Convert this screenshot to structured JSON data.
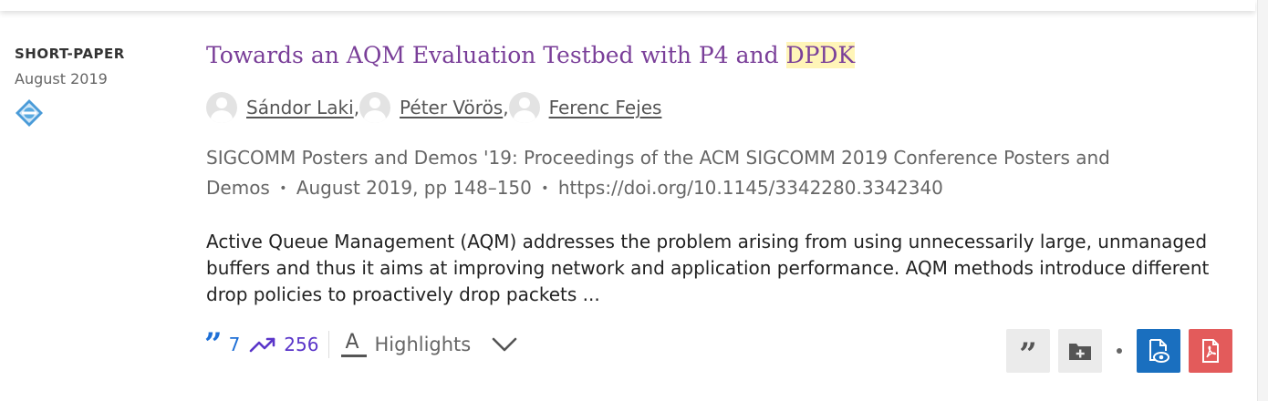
{
  "item": {
    "content_type": "SHORT-PAPER",
    "date": "August 2019",
    "badge_icon": "acm-diamond-icon",
    "title_prefix": "Towards an AQM Evaluation Testbed with P4 and ",
    "title_highlight": "DPDK",
    "authors": [
      {
        "name": "Sándor Laki",
        "sep": ","
      },
      {
        "name": "Péter Vörös",
        "sep": ","
      },
      {
        "name": "Ferenc Fejes",
        "sep": ""
      }
    ],
    "venue_line1": "SIGCOMM Posters and Demos '19: Proceedings of the ACM SIGCOMM 2019 Conference Posters and",
    "venue_line2_prefix": "Demos",
    "venue_dot": "•",
    "venue_pages": "August 2019, pp 148–150",
    "venue_doi": "https://doi.org/10.1145/3342280.3342340",
    "abstract": "Active Queue Management (AQM) addresses the problem arising from using unnecessarily large, unmanaged buffers and thus it aims at improving network and application performance. AQM methods introduce different drop policies to proactively drop packets ...",
    "metrics": {
      "citations_icon": "quote-icon",
      "citations": "7",
      "downloads_icon": "trending-up-icon",
      "downloads": "256",
      "highlights_icon": "text-highlight-icon",
      "highlights_label": "Highlights",
      "expand_icon": "chevron-down-icon"
    },
    "actions": [
      {
        "icon": "quote-icon",
        "color": "#ebebeb"
      },
      {
        "icon": "folder-add-icon",
        "color": "#ebebeb"
      },
      {
        "icon": "eye-document-icon",
        "color": "#1a6fbf"
      },
      {
        "icon": "pdf-icon",
        "color": "#e35b5b"
      }
    ]
  },
  "colors": {
    "title": "#7a3f99",
    "title_highlight_bg": "#fff5b8",
    "citations": "#1e6fd6",
    "downloads": "#5a35c9"
  }
}
